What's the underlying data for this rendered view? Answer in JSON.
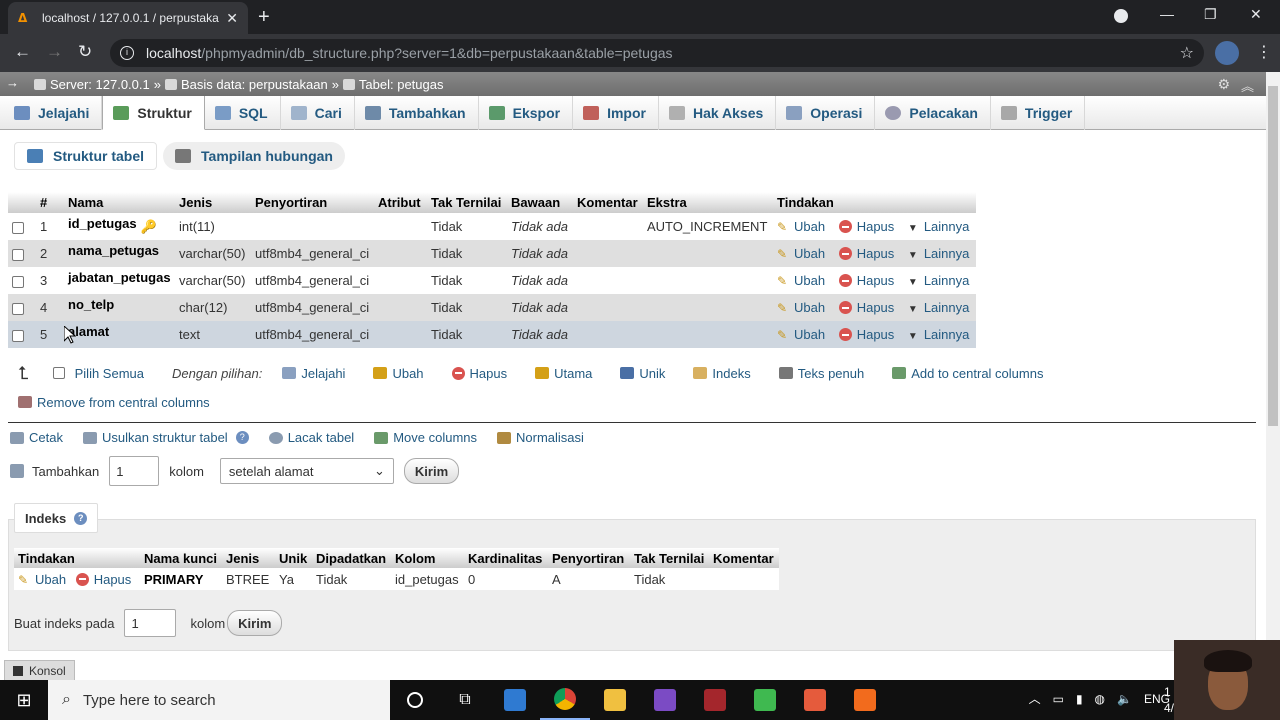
{
  "browser": {
    "tab_title": "localhost / 127.0.0.1 / perpustaka",
    "url_host": "localhost",
    "url_path": "/phpmyadmin/db_structure.php?server=1&db=perpustakaan&table=petugas"
  },
  "breadcrumb": {
    "server": "Server: 127.0.0.1",
    "database": "Basis data: perpustakaan",
    "table": "Tabel: petugas"
  },
  "tabs": [
    "Jelajahi",
    "Struktur",
    "SQL",
    "Cari",
    "Tambahkan",
    "Ekspor",
    "Impor",
    "Hak Akses",
    "Operasi",
    "Pelacakan",
    "Trigger"
  ],
  "active_tab": "Struktur",
  "subtabs": [
    "Struktur tabel",
    "Tampilan hubungan"
  ],
  "structure": {
    "headers": [
      "#",
      "Nama",
      "Jenis",
      "Penyortiran",
      "Atribut",
      "Tak Ternilai",
      "Bawaan",
      "Komentar",
      "Ekstra",
      "Tindakan"
    ],
    "rows": [
      {
        "num": "1",
        "name": "id_petugas",
        "type": "int(11)",
        "collation": "",
        "null": "Tidak",
        "default": "Tidak ada",
        "extra": "AUTO_INCREMENT"
      },
      {
        "num": "2",
        "name": "nama_petugas",
        "type": "varchar(50)",
        "collation": "utf8mb4_general_ci",
        "null": "Tidak",
        "default": "Tidak ada",
        "extra": ""
      },
      {
        "num": "3",
        "name": "jabatan_petugas",
        "type": "varchar(50)",
        "collation": "utf8mb4_general_ci",
        "null": "Tidak",
        "default": "Tidak ada",
        "extra": ""
      },
      {
        "num": "4",
        "name": "no_telp",
        "type": "char(12)",
        "collation": "utf8mb4_general_ci",
        "null": "Tidak",
        "default": "Tidak ada",
        "extra": ""
      },
      {
        "num": "5",
        "name": "alamat",
        "type": "text",
        "collation": "utf8mb4_general_ci",
        "null": "Tidak",
        "default": "Tidak ada",
        "extra": ""
      }
    ],
    "actions": {
      "edit": "Ubah",
      "drop": "Hapus",
      "more": "Lainnya"
    }
  },
  "bulk": {
    "check_all": "Pilih Semua",
    "with_selected": "Dengan pilihan:",
    "actions": [
      "Jelajahi",
      "Ubah",
      "Hapus",
      "Utama",
      "Unik",
      "Indeks",
      "Teks penuh",
      "Add to central columns"
    ],
    "remove_central": "Remove from central columns"
  },
  "tools": [
    "Cetak",
    "Usulkan struktur tabel",
    "Lacak tabel",
    "Move columns",
    "Normalisasi"
  ],
  "add_columns": {
    "label": "Tambahkan",
    "count": "1",
    "unit": "kolom",
    "position": "setelah alamat",
    "submit": "Kirim"
  },
  "indexes": {
    "title": "Indeks",
    "headers": [
      "Tindakan",
      "Nama kunci",
      "Jenis",
      "Unik",
      "Dipadatkan",
      "Kolom",
      "Kardinalitas",
      "Penyortiran",
      "Tak Ternilai",
      "Komentar"
    ],
    "row": {
      "edit": "Ubah",
      "drop": "Hapus",
      "key": "PRIMARY",
      "type": "BTREE",
      "unique": "Ya",
      "packed": "Tidak",
      "column": "id_petugas",
      "cardinality": "0",
      "collation": "A",
      "null": "Tidak",
      "comment": ""
    },
    "create_label": "Buat indeks pada",
    "create_count": "1",
    "create_unit": "kolom",
    "create_submit": "Kirim"
  },
  "console": "Konsol",
  "taskbar": {
    "search_placeholder": "Type here to search",
    "lang": "ENG",
    "time": "1",
    "date": "4/"
  }
}
